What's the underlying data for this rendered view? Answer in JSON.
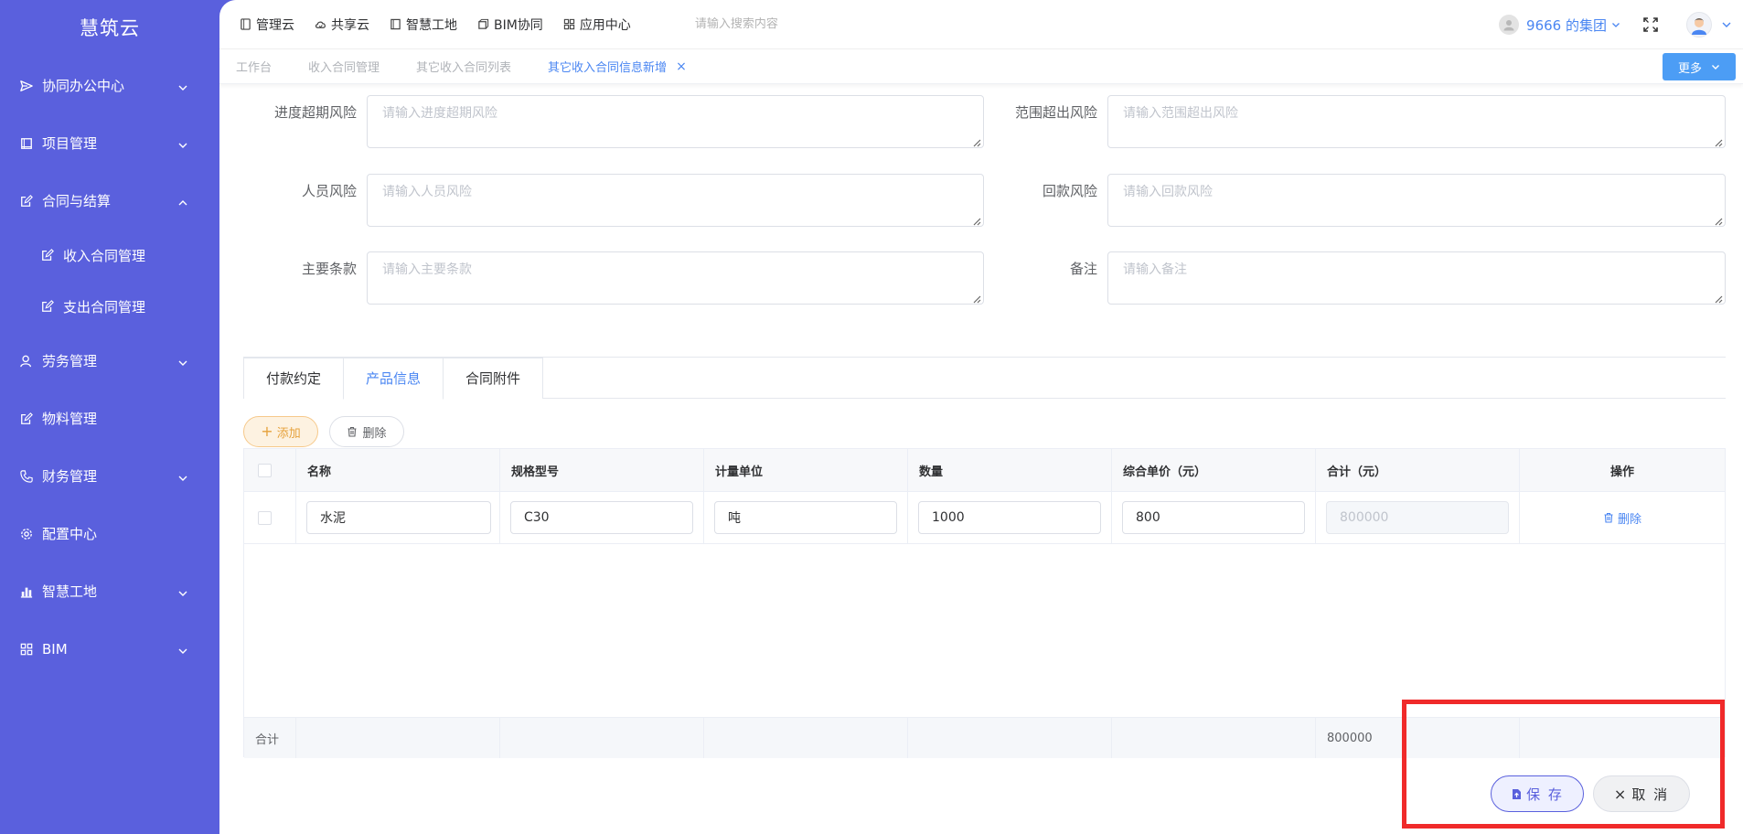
{
  "brand": "慧筑云",
  "sidebar": {
    "items": [
      {
        "label": "协同办公中心",
        "icon": "send-icon",
        "arrow": "down"
      },
      {
        "label": "项目管理",
        "icon": "book-icon",
        "arrow": "down"
      },
      {
        "label": "合同与结算",
        "icon": "edit-icon",
        "arrow": "up",
        "expanded": true
      },
      {
        "label": "劳务管理",
        "icon": "worker-icon",
        "arrow": "down"
      },
      {
        "label": "物料管理",
        "icon": "edit-icon",
        "arrow": "none"
      },
      {
        "label": "财务管理",
        "icon": "phone-icon",
        "arrow": "down"
      },
      {
        "label": "配置中心",
        "icon": "gear-icon",
        "arrow": "none"
      },
      {
        "label": "智慧工地",
        "icon": "bar-chart-icon",
        "arrow": "down"
      },
      {
        "label": "BIM",
        "icon": "grid-icon",
        "arrow": "down"
      }
    ],
    "subitems": [
      {
        "label": "收入合同管理",
        "icon": "edit-icon"
      },
      {
        "label": "支出合同管理",
        "icon": "edit-icon"
      }
    ]
  },
  "topnav": {
    "links": [
      {
        "label": "管理云",
        "icon": "tablet-icon"
      },
      {
        "label": "共享云",
        "icon": "cloud-icon"
      },
      {
        "label": "智慧工地",
        "icon": "book-icon"
      },
      {
        "label": "BIM协同",
        "icon": "cube-icon"
      },
      {
        "label": "应用中心",
        "icon": "grid-icon"
      }
    ],
    "search_placeholder": "请输入搜索内容",
    "org": "9666 的集团"
  },
  "tabs": {
    "items": [
      "工作台",
      "收入合同管理",
      "其它收入合同列表"
    ],
    "active": "其它收入合同信息新增",
    "more": "更多"
  },
  "form": {
    "rows": [
      {
        "left_label": "进度超期风险",
        "left_placeholder": "请输入进度超期风险",
        "right_label": "范围超出风险",
        "right_placeholder": "请输入范围超出风险"
      },
      {
        "left_label": "人员风险",
        "left_placeholder": "请输入人员风险",
        "right_label": "回款风险",
        "right_placeholder": "请输入回款风险"
      },
      {
        "left_label": "主要条款",
        "left_placeholder": "请输入主要条款",
        "right_label": "备注",
        "right_placeholder": "请输入备注"
      }
    ]
  },
  "content_tabs": [
    "付款约定",
    "产品信息",
    "合同附件"
  ],
  "content_tabs_active": 1,
  "toolbar": {
    "add": "添加",
    "delete": "删除"
  },
  "table": {
    "headers": [
      "名称",
      "规格型号",
      "计量单位",
      "数量",
      "综合单价（元）",
      "合计（元）",
      "操作"
    ],
    "rows": [
      {
        "name": "水泥",
        "spec": "C30",
        "unit": "吨",
        "qty": "1000",
        "price": "800",
        "total": "800000",
        "op": "删除"
      }
    ],
    "footer_label": "合计",
    "footer_total": "800000"
  },
  "actions": {
    "save": "保 存",
    "cancel": "取 消"
  },
  "colors": {
    "sidebar": "#5a60dd",
    "accent": "#4a86f2",
    "highlight": "#f02a2a",
    "add": "#e6a23c"
  }
}
